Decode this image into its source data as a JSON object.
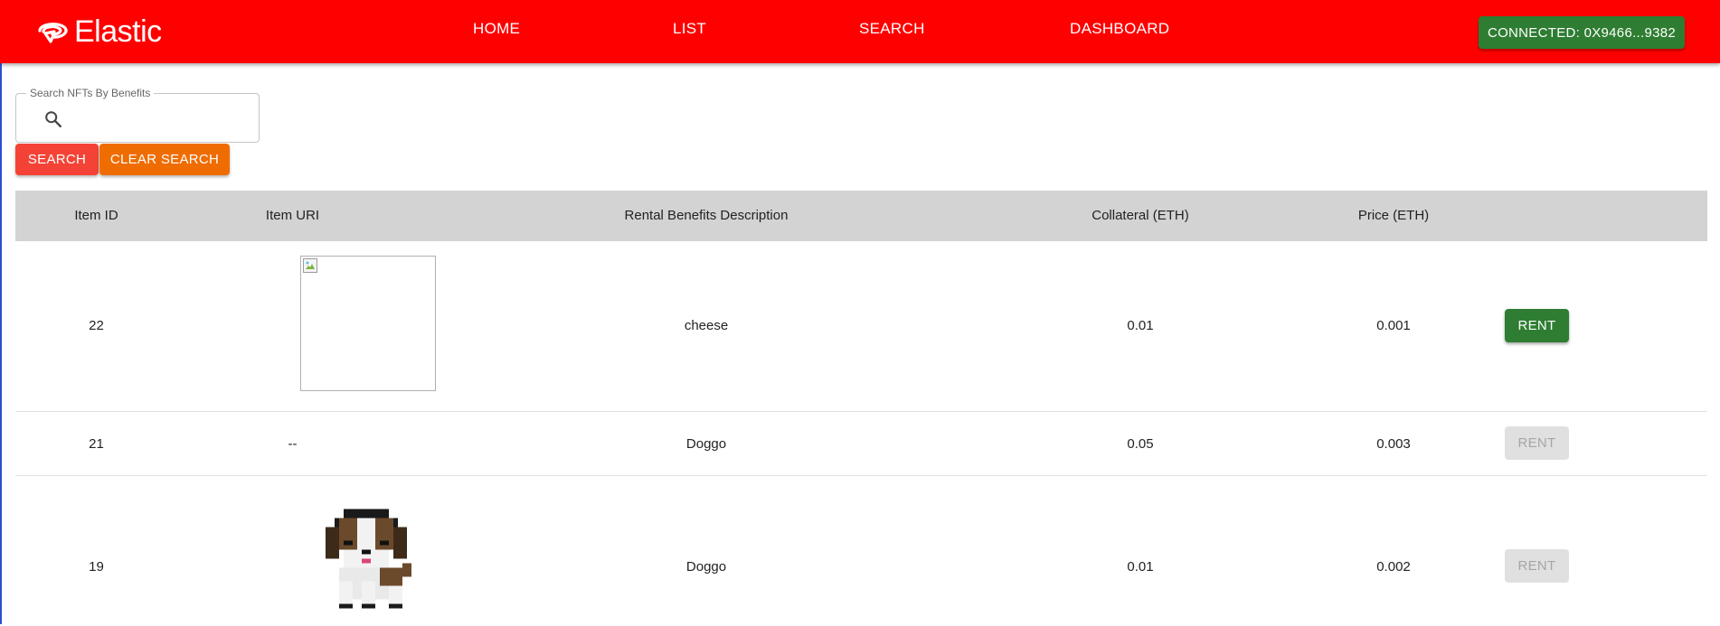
{
  "header": {
    "brand": "Elastic",
    "nav": [
      "HOME",
      "LIST",
      "SEARCH",
      "DASHBOARD"
    ],
    "connected_label": "CONNECTED: 0X9466...9382"
  },
  "search": {
    "legend": "Search NFTs By Benefits",
    "value": "",
    "placeholder": "",
    "search_label": "SEARCH",
    "clear_label": "CLEAR SEARCH"
  },
  "table": {
    "columns": [
      "Item ID",
      "Item URI",
      "Rental Benefits Description",
      "Collateral (ETH)",
      "Price (ETH)"
    ],
    "rows": [
      {
        "id": "22",
        "uri": "",
        "benefits": "cheese",
        "collateral": "0.01",
        "price": "0.001",
        "action": "RENT",
        "enabled": true
      },
      {
        "id": "21",
        "uri": "--",
        "benefits": "Doggo",
        "collateral": "0.05",
        "price": "0.003",
        "action": "RENT",
        "enabled": false
      },
      {
        "id": "19",
        "uri": "",
        "benefits": "Doggo",
        "collateral": "0.01",
        "price": "0.002",
        "action": "RENT",
        "enabled": false
      }
    ]
  },
  "colors": {
    "appbar": "#ff0000",
    "connected": "#2e7d32",
    "search_button": "#f44336",
    "clear_button": "#ef6c00",
    "rent_active": "#2e7d32",
    "header_row": "#d3d3d3"
  },
  "icons": [
    "brand-logo-icon",
    "search-icon",
    "broken-image-icon",
    "dog-image"
  ]
}
